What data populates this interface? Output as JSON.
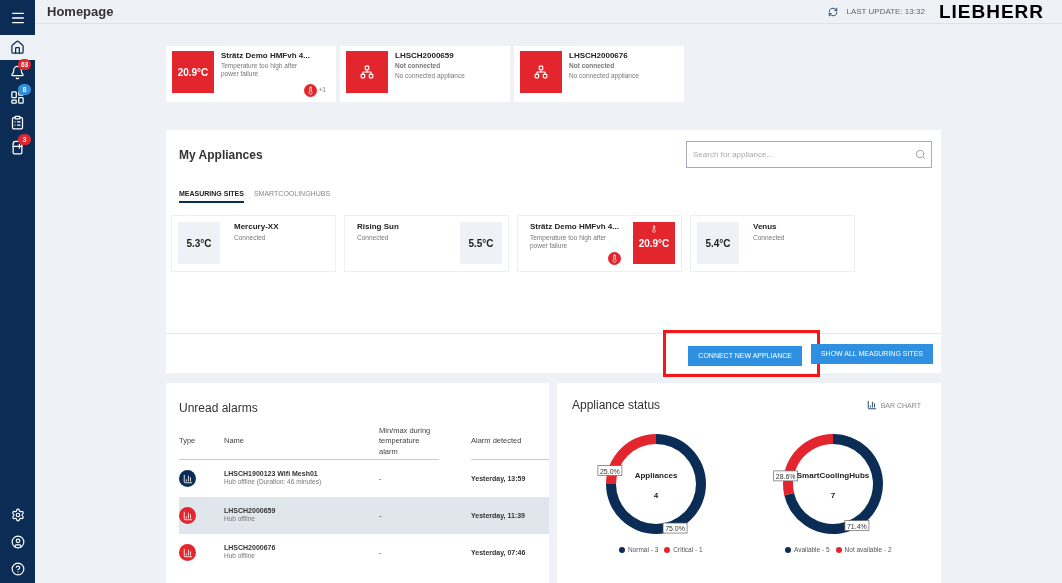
{
  "header": {
    "title": "Homepage",
    "last_update": "LAST UPDATE: 13:32",
    "logo": "LIEBHERR"
  },
  "sidebar": {
    "items": [
      {
        "kind": "home",
        "selected": true
      },
      {
        "kind": "bell",
        "selected": false,
        "badge": {
          "text": "63",
          "color": "#e3262d"
        }
      },
      {
        "kind": "dashboard",
        "selected": false,
        "badge": {
          "text": "8",
          "color": "#2f8fe0"
        }
      },
      {
        "kind": "clipboard",
        "selected": false
      },
      {
        "kind": "fridge",
        "selected": false,
        "badge": {
          "text": "3",
          "color": "#e3262d"
        }
      }
    ],
    "bottom_items": [
      {
        "kind": "settings"
      },
      {
        "kind": "user"
      },
      {
        "kind": "help"
      }
    ]
  },
  "alert_cards": [
    {
      "kind": "temperature",
      "value": "20.9°C",
      "name": "Strätz Demo HMFvh 4...",
      "status": "Temperature too high after power failure",
      "extra": "+1"
    },
    {
      "kind": "hub",
      "name": "LHSCH2000659",
      "status": "Not connected",
      "detail": "No connected appliance"
    },
    {
      "kind": "hub",
      "name": "LHSCH2000676",
      "status": "Not connected",
      "detail": "No connected appliance"
    }
  ],
  "appliances": {
    "title": "My Appliances",
    "search": {
      "placeholder": "Search for appliance..."
    },
    "tabs": [
      {
        "label": "MEASURING SITES",
        "selected": true
      },
      {
        "label": "SMARTCOOLINGHUBS",
        "selected": false
      }
    ],
    "sites": [
      {
        "name": "Mercury-XX",
        "status": "Connected",
        "temperature": "5.3°C",
        "kind": "temp_left",
        "alarm": false
      },
      {
        "name": "Rising Sun",
        "status": "Connected",
        "temperature": "5.5°C",
        "kind": "temp_right",
        "alarm": false
      },
      {
        "name": "Strätz Demo HMFvh 4...",
        "status": "Temperature too high after power failure",
        "temperature": "20.9°C",
        "kind": "temp_right",
        "alarm": true
      },
      {
        "name": "Venus",
        "status": "Connected",
        "temperature": "5.4°C",
        "kind": "temp_left",
        "alarm": false
      }
    ],
    "buttons": [
      {
        "label": "CONNECT NEW APPLIANCE",
        "highlighted": true
      },
      {
        "label": "SHOW ALL MEASURING SITES",
        "highlighted": false
      }
    ]
  },
  "alarms": {
    "title": "Unread alarms",
    "columns": [
      "Type",
      "Name",
      "Min/max during temperature alarm",
      "Alarm detected"
    ],
    "rows": [
      {
        "color": "#0b2d55",
        "name": "LHSCH1900123 Wifi Mesh01",
        "detail": "Hub offline (Duration: 46 minutes)",
        "minmax": "-",
        "detected": "Yesterday, 13:59",
        "highlighted": false
      },
      {
        "color": "#e3262d",
        "name": "LHSCH2000659",
        "detail": "Hub offline",
        "minmax": "-",
        "detected": "Yesterday, 11:39",
        "highlighted": true
      },
      {
        "color": "#e3262d",
        "name": "LHSCH2000676",
        "detail": "Hub offline",
        "minmax": "-",
        "detected": "Yesterday, 07:46",
        "highlighted": false
      }
    ]
  },
  "status": {
    "title": "Appliance status",
    "toggle": "BAR CHART",
    "charts": [
      {
        "total": "4",
        "legend": [
          {
            "color": "#0b2d55"
          },
          {
            "color": "#e3262d"
          }
        ],
        "chart_data": {
          "type": "donut",
          "title": "Appliances",
          "categories": [
            "Normal - 3",
            "Critical - 1"
          ],
          "values": [
            75.0,
            25.0
          ],
          "value_labels": [
            "75.0%",
            "25.0%"
          ]
        }
      },
      {
        "total": "7",
        "legend": [
          {
            "color": "#0b2d55"
          },
          {
            "color": "#e3262d"
          }
        ],
        "chart_data": {
          "type": "donut",
          "title": "SmartCoolingHubs",
          "categories": [
            "Available - 5",
            "Not available - 2"
          ],
          "values": [
            71.4,
            28.6
          ],
          "value_labels": [
            "71.4%",
            "28.6%"
          ]
        }
      }
    ]
  }
}
